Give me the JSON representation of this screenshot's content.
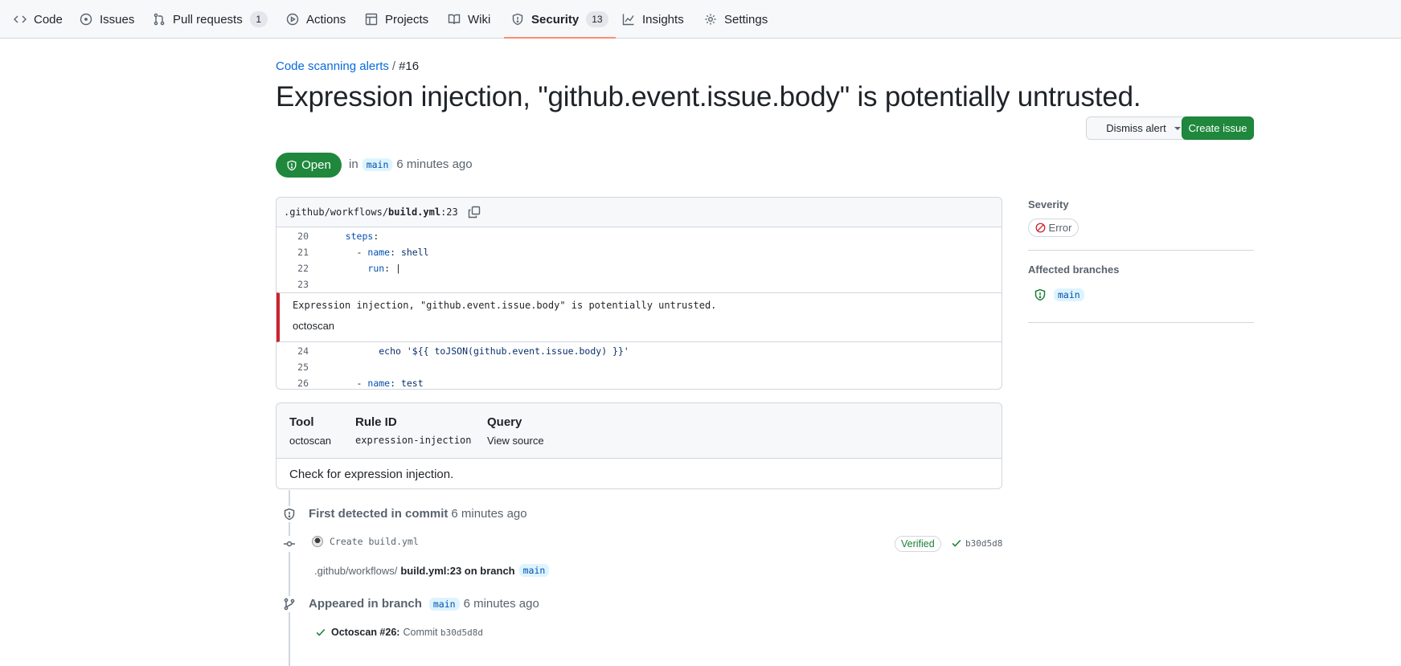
{
  "nav": {
    "tabs": [
      {
        "label": "Code",
        "icon": "code-icon"
      },
      {
        "label": "Issues",
        "icon": "issue-opened-icon"
      },
      {
        "label": "Pull requests",
        "icon": "git-pull-request-icon",
        "count": "1"
      },
      {
        "label": "Actions",
        "icon": "play-icon"
      },
      {
        "label": "Projects",
        "icon": "table-icon"
      },
      {
        "label": "Wiki",
        "icon": "book-icon"
      },
      {
        "label": "Security",
        "icon": "shield-icon",
        "count": "13",
        "active": true
      },
      {
        "label": "Insights",
        "icon": "graph-icon"
      },
      {
        "label": "Settings",
        "icon": "gear-icon"
      }
    ]
  },
  "breadcrumb": {
    "parent": "Code scanning alerts",
    "sep": "/",
    "current": "#16"
  },
  "alert": {
    "title": "Expression injection, \"github.event.issue.body\" is potentially untrusted.",
    "state": "Open",
    "in_word": "in",
    "branch": "main",
    "time": "6 minutes ago"
  },
  "actions": {
    "dismiss": "Dismiss alert",
    "create_issue": "Create issue"
  },
  "code": {
    "path_prefix": ".github/workflows/",
    "file": "build.yml",
    "line_suffix": ":23",
    "lines_before": [
      {
        "n": "20",
        "indent": "    ",
        "key": "steps",
        "rest": ":"
      },
      {
        "n": "21",
        "indent": "      - ",
        "key": "name",
        "rest": ": shell"
      },
      {
        "n": "22",
        "indent": "        ",
        "key": "run",
        "rest": ": |"
      },
      {
        "n": "23",
        "indent": "",
        "key": "",
        "rest": ""
      }
    ],
    "alert_message": "Expression injection, \"github.event.issue.body\" is potentially untrusted.",
    "alert_tool": "octoscan",
    "lines_after": [
      {
        "n": "24",
        "indent": "          ",
        "key": "",
        "rest": "echo '${{ toJSON(github.event.issue.body) }}'"
      },
      {
        "n": "25",
        "indent": "",
        "key": "",
        "rest": ""
      },
      {
        "n": "26",
        "indent": "      - ",
        "key": "name",
        "rest": ": test"
      }
    ]
  },
  "tool": {
    "tool_label": "Tool",
    "tool_value": "octoscan",
    "rule_label": "Rule ID",
    "rule_value": "expression-injection",
    "query_label": "Query",
    "query_value": "View source",
    "description": "Check for expression injection."
  },
  "sidebar": {
    "severity_label": "Severity",
    "severity_value": "Error",
    "branches_label": "Affected branches",
    "branch": "main"
  },
  "timeline": {
    "first_detected": "First detected in commit",
    "first_time": "6 minutes ago",
    "commit_msg": "Create build.yml",
    "verified": "Verified",
    "sha": "b30d5d8",
    "path_prefix": ".github/workflows/",
    "path_bold": "build.yml:23 on branch",
    "path_branch": "main",
    "appeared": "Appeared in branch",
    "appeared_branch": "main",
    "appeared_time": "6 minutes ago",
    "run_name": "Octoscan #26:",
    "run_commit": "Commit",
    "run_sha": "b30d5d8d"
  },
  "colors": {
    "accent": "#0969da",
    "open_green": "#1f883d",
    "error_red": "#cf222e",
    "tab_underline": "#fd8c73"
  }
}
